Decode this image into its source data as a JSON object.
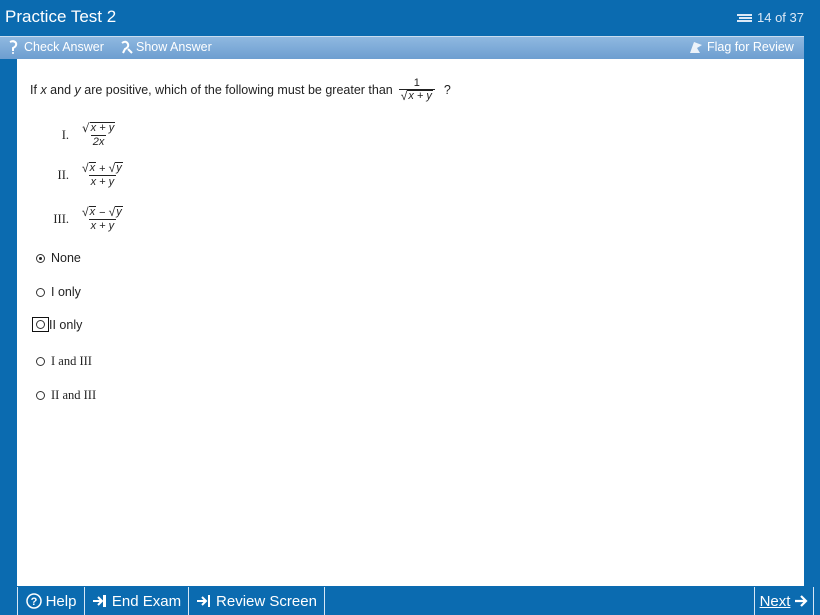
{
  "window": {
    "title": "Practice Test 2",
    "counter": "14 of 37"
  },
  "toolbar": {
    "check_answer": "Check Answer",
    "show_answer": "Show Answer",
    "flag": "Flag for Review"
  },
  "question": {
    "prefix": "If",
    "var_x": "x",
    "and": "and",
    "var_y": "y",
    "rest": "are positive, which of the following must be greater than",
    "frac_num": "1",
    "frac_den": "x + y",
    "suffix": "?"
  },
  "statements": [
    {
      "label": "I.",
      "num": "x + y",
      "den": "2x"
    },
    {
      "label": "II.",
      "num_a": "x",
      "op": "+",
      "num_b": "y",
      "den": "x + y"
    },
    {
      "label": "III.",
      "num_a": "x",
      "op": "−",
      "num_b": "y",
      "den": "x + y"
    }
  ],
  "choices": [
    {
      "label": "None",
      "selected": true
    },
    {
      "label": "I only",
      "selected": false
    },
    {
      "label": "II only",
      "selected": false
    },
    {
      "label": "I and III",
      "selected": false
    },
    {
      "label": "II and III",
      "selected": false
    }
  ],
  "bottom": {
    "help": "Help",
    "end_exam": "End Exam",
    "review": "Review Screen",
    "next": "Next"
  }
}
